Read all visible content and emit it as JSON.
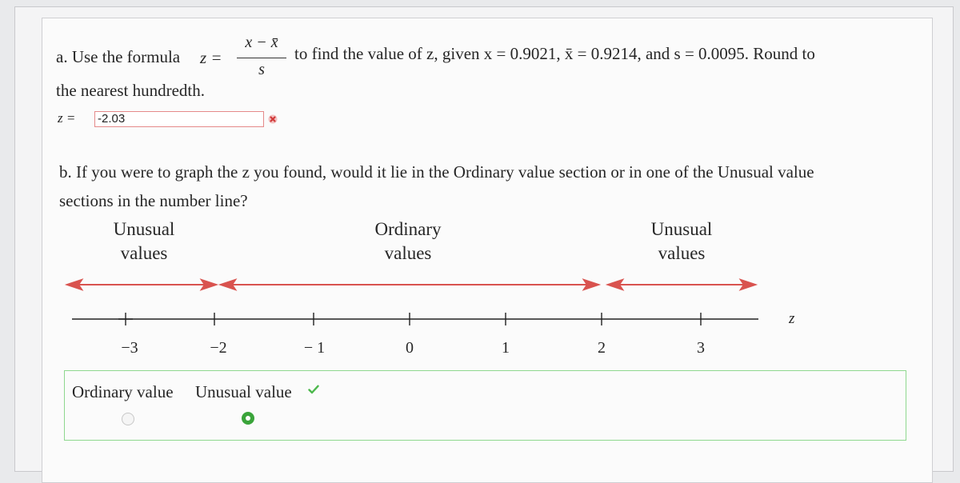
{
  "part_a": {
    "prefix": "a. Use the formula",
    "z_eq": "z =",
    "numerator": "x − x̄",
    "denominator": "s",
    "line1_suffix": "to find the value of z, given x = 0.9021, x̄ = 0.9214, and s = 0.0095. Round to",
    "line2": "the nearest hundredth.",
    "answer_label": "z =",
    "answer_value": "-2.03",
    "answer_status_icon": "red-x-icon"
  },
  "part_b": {
    "line1": "b. If you were to graph the z you found, would it lie in the Ordinary value section or in one of the Unusual value",
    "line2": "sections in the number line?"
  },
  "number_line": {
    "labels": [
      {
        "line1": "Unusual",
        "line2": "values"
      },
      {
        "line1": "Ordinary",
        "line2": "values"
      },
      {
        "line1": "Unusual",
        "line2": "values"
      }
    ],
    "ticks": [
      "−3",
      "−2",
      "− 1",
      "0",
      "1",
      "2",
      "3"
    ],
    "axis_label": "z",
    "arrow_color": "#d9534f"
  },
  "choices": {
    "options": [
      "Ordinary value",
      "Unusual value"
    ],
    "selected": "Unusual value",
    "status_icon": "green-check-icon",
    "accent": "#3aa43a"
  }
}
